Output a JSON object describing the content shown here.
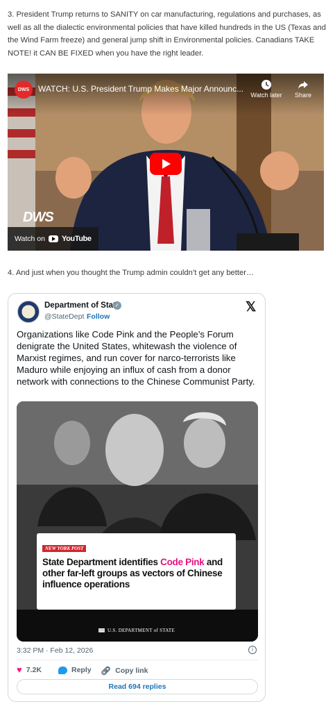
{
  "article": {
    "item3": "3. President Trump returns to SANITY on car manufacturing, regulations and purchases, as well as all the dialectic environmental policies that have killed hundreds in the US (Texas and the Wind Farm freeze) and general jump shift in Environmental policies. Canadians TAKE NOTE! it CAN BE FIXED when you have the right leader.",
    "item4": "4. And just when you thought the Trump admin couldn’t get any better…"
  },
  "video": {
    "channel_logo": "DWS",
    "title": "WATCH: U.S. President Trump Makes Major Announc...",
    "watch_later": "Watch later",
    "share": "Share",
    "watermark": "DWS",
    "watch_on": "Watch on",
    "youtube": "YouTube",
    "icons": [
      "clock-icon",
      "share-arrow-icon",
      "play-icon",
      "youtube-icon"
    ]
  },
  "tweet": {
    "account_name": "Department of State",
    "handle": "@StateDept",
    "separator": "·",
    "follow": "Follow",
    "text": "Organizations like Code Pink and the People’s Forum denigrate the United States, whitewash the violence of Marxist regimes, and run cover for narco-terrorists like Maduro while enjoying an influx of cash from a donor network with connections to the Chinese Communist Party.",
    "image": {
      "source_tag": "NEW YORK POST",
      "headline_pre": "State Department identifies ",
      "headline_highlight": "Code Pink",
      "headline_post": " and other far-left groups as vectors of Chinese influence operations",
      "footer": "U.S. DEPARTMENT of STATE"
    },
    "timestamp": "3:32 PM · Feb 12, 2026",
    "likes": "7.2K",
    "reply_label": "Reply",
    "copy_link_label": "Copy link",
    "read_replies": "Read 694 replies",
    "colors": {
      "link": "#1d74b9",
      "like": "#f91880",
      "highlight": "#e3127e"
    }
  }
}
